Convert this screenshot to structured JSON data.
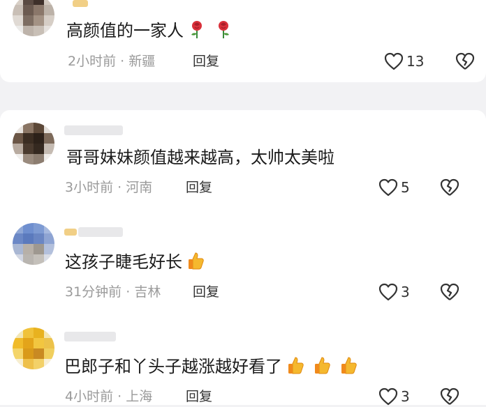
{
  "comments": [
    {
      "text": "高颜值的一家人",
      "emoji": [
        "rose-icon",
        "rose-icon"
      ],
      "time": "2小时前",
      "location": "新疆",
      "reply_label": "回复",
      "likes": "13"
    },
    {
      "text": "哥哥妹妹颜值越来越高，太帅太美啦",
      "emoji": [],
      "time": "3小时前",
      "location": "河南",
      "reply_label": "回复",
      "likes": "5"
    },
    {
      "text": "这孩子睫毛好长",
      "emoji": [
        "thumbs-up-icon"
      ],
      "time": "31分钟前",
      "location": "吉林",
      "reply_label": "回复",
      "likes": "3"
    },
    {
      "text": "巴郎子和丫头子越涨越好看了",
      "emoji": [
        "thumbs-up-icon",
        "thumbs-up-icon",
        "thumbs-up-icon"
      ],
      "time": "4小时前",
      "location": "上海",
      "reply_label": "回复",
      "likes": "3"
    }
  ],
  "separator": "·",
  "colors": {
    "background": "#f2f2f4",
    "card": "#ffffff",
    "meta_gray": "#9a9a9a",
    "heart_outline": "#333333"
  }
}
